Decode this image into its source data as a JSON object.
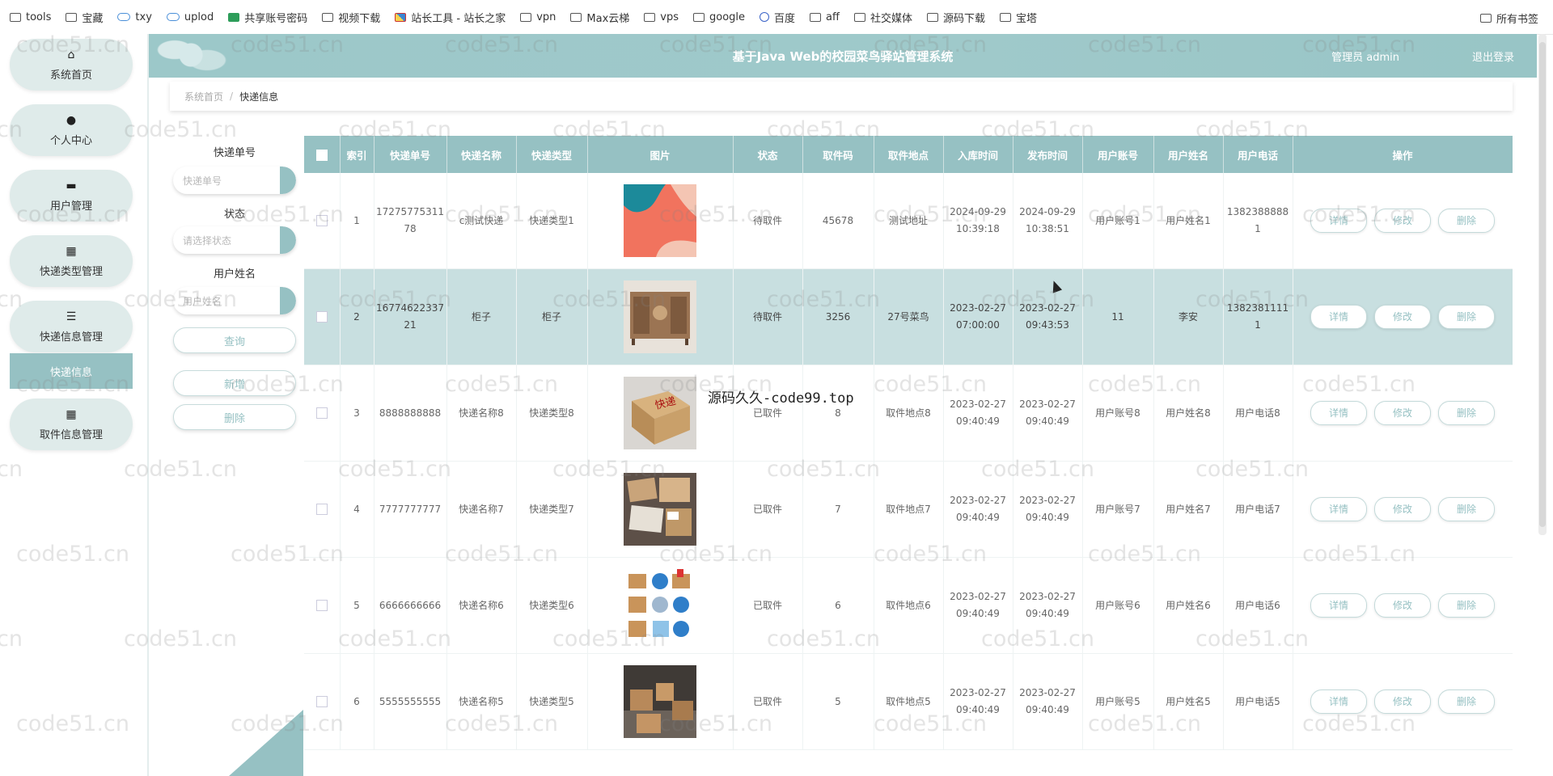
{
  "bookmarks": {
    "items": [
      {
        "label": "tools",
        "icon": "folder-icon"
      },
      {
        "label": "宝藏",
        "icon": "folder-icon"
      },
      {
        "label": "txy",
        "icon": "cloud-icon"
      },
      {
        "label": "uplod",
        "icon": "cloud-icon"
      },
      {
        "label": "共享账号密码",
        "icon": "sheet-icon"
      },
      {
        "label": "视频下载",
        "icon": "folder-icon"
      },
      {
        "label": "站长工具 - 站长之家",
        "icon": "tool-icon"
      },
      {
        "label": "vpn",
        "icon": "folder-icon"
      },
      {
        "label": "Max云梯",
        "icon": "folder-icon"
      },
      {
        "label": "vps",
        "icon": "folder-icon"
      },
      {
        "label": "google",
        "icon": "folder-icon"
      },
      {
        "label": "百度",
        "icon": "baidu-icon"
      },
      {
        "label": "aff",
        "icon": "folder-icon"
      },
      {
        "label": "社交媒体",
        "icon": "folder-icon"
      },
      {
        "label": "源码下载",
        "icon": "folder-icon"
      },
      {
        "label": "宝塔",
        "icon": "folder-icon"
      }
    ],
    "all_bookmarks": "所有书签"
  },
  "sidebar": {
    "items": [
      {
        "label": "系统首页",
        "icon": "home-icon"
      },
      {
        "label": "个人中心",
        "icon": "user-icon"
      },
      {
        "label": "用户管理",
        "icon": "monitor-icon"
      },
      {
        "label": "快递类型管理",
        "icon": "grid-icon"
      },
      {
        "label": "快递信息管理",
        "icon": "list-icon"
      },
      {
        "label": "取件信息管理",
        "icon": "grid-icon"
      }
    ],
    "sub_active": "快递信息"
  },
  "header": {
    "title": "基于Java Web的校园菜鸟驿站管理系统",
    "user": "管理员 admin",
    "logout": "退出登录"
  },
  "breadcrumb": {
    "home": "系统首页",
    "sep": "/",
    "current": "快递信息"
  },
  "search": {
    "f1_label": "快递单号",
    "f1_placeholder": "快递单号",
    "f2_label": "状态",
    "f2_placeholder": "请选择状态",
    "f3_label": "用户姓名",
    "f3_placeholder": "用户姓名",
    "query": "查询",
    "add": "新增",
    "delete": "删除"
  },
  "table": {
    "headers": [
      "索引",
      "快递单号",
      "快递名称",
      "快递类型",
      "图片",
      "状态",
      "取件码",
      "取件地点",
      "入库时间",
      "发布时间",
      "用户账号",
      "用户姓名",
      "用户电话",
      "操作"
    ],
    "op_detail": "详情",
    "op_edit": "修改",
    "op_delete": "删除",
    "rows": [
      {
        "idx": "1",
        "no": "1727577531178",
        "name": "c测试快递",
        "type": "快递类型1",
        "img": "abstract",
        "status": "待取件",
        "code": "45678",
        "place": "测试地址",
        "in": "2024-09-29 10:39:18",
        "pub": "2024-09-29 10:38:51",
        "acct": "用户账号1",
        "uname": "用户姓名1",
        "phone": "13823888881"
      },
      {
        "idx": "2",
        "no": "1677462233721",
        "name": "柜子",
        "type": "柜子",
        "img": "cabinet",
        "status": "待取件",
        "code": "3256",
        "place": "27号菜鸟",
        "in": "2023-02-27 07:00:00",
        "pub": "2023-02-27 09:43:53",
        "acct": "11",
        "uname": "李安",
        "phone": "13823811111"
      },
      {
        "idx": "3",
        "no": "8888888888",
        "name": "快递名称8",
        "type": "快递类型8",
        "img": "box",
        "status": "已取件",
        "code": "8",
        "place": "取件地点8",
        "in": "2023-02-27 09:40:49",
        "pub": "2023-02-27 09:40:49",
        "acct": "用户账号8",
        "uname": "用户姓名8",
        "phone": "用户电话8"
      },
      {
        "idx": "4",
        "no": "7777777777",
        "name": "快递名称7",
        "type": "快递类型7",
        "img": "parcels",
        "status": "已取件",
        "code": "7",
        "place": "取件地点7",
        "in": "2023-02-27 09:40:49",
        "pub": "2023-02-27 09:40:49",
        "acct": "用户账号7",
        "uname": "用户姓名7",
        "phone": "用户电话7"
      },
      {
        "idx": "5",
        "no": "6666666666",
        "name": "快递名称6",
        "type": "快递类型6",
        "img": "icons",
        "status": "已取件",
        "code": "6",
        "place": "取件地点6",
        "in": "2023-02-27 09:40:49",
        "pub": "2023-02-27 09:40:49",
        "acct": "用户账号6",
        "uname": "用户姓名6",
        "phone": "用户电话6"
      },
      {
        "idx": "6",
        "no": "5555555555",
        "name": "快递名称5",
        "type": "快递类型5",
        "img": "warehouse",
        "status": "已取件",
        "code": "5",
        "place": "取件地点5",
        "in": "2023-02-27 09:40:49",
        "pub": "2023-02-27 09:40:49",
        "acct": "用户账号5",
        "uname": "用户姓名5",
        "phone": "用户电话5"
      }
    ]
  },
  "watermark": {
    "text": "code51.cn",
    "overlay": "源码久久-code99.top"
  },
  "colors": {
    "accent": "#96c1c3",
    "header": "#9cc8c9",
    "row_highlight": "#c8dfe0",
    "menu_bg": "#dfebea"
  }
}
